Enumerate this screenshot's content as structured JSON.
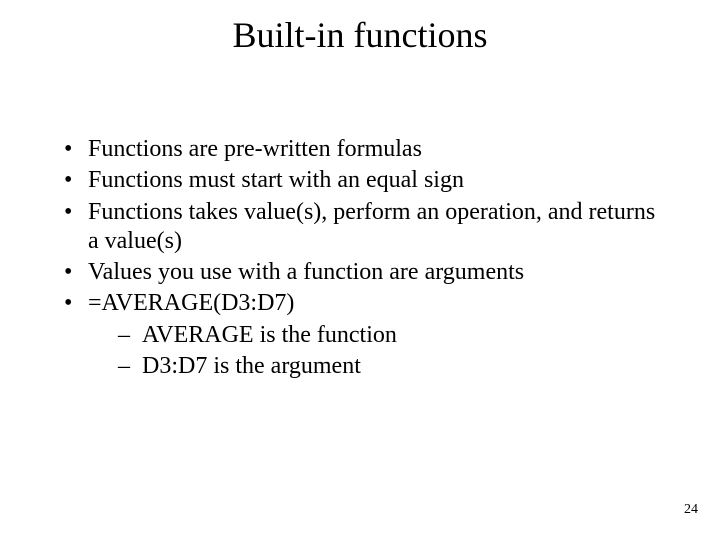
{
  "title": "Built-in functions",
  "bullets": {
    "b0": "Functions are pre-written formulas",
    "b1": "Functions must start with an equal sign",
    "b2": "Functions takes value(s), perform an operation, and returns a value(s)",
    "b3": "Values you use with a function are arguments",
    "b4": "=AVERAGE(D3:D7)",
    "b4sub": {
      "s0": "AVERAGE is the function",
      "s1": "D3:D7 is the argument"
    }
  },
  "page_number": "24"
}
